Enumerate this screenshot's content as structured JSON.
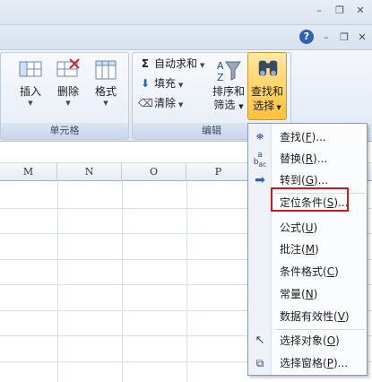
{
  "window_controls": {
    "top": {
      "minimize": "–",
      "restore": "❐",
      "close": "✕"
    },
    "workbook": {
      "help": "?",
      "minimize": "–",
      "restore": "❐",
      "close": "✕"
    }
  },
  "ribbon": {
    "cells_group": {
      "label": "单元格",
      "buttons": [
        {
          "label": "插入",
          "icon": "insert-cells-icon"
        },
        {
          "label": "删除",
          "icon": "delete-cells-icon"
        },
        {
          "label": "格式",
          "icon": "format-cells-icon"
        }
      ]
    },
    "editing_group": {
      "label": "编辑",
      "autosum": "自动求和",
      "fill": "填充",
      "clear": "清除",
      "sort_filter": {
        "line1": "排序和",
        "line2": "筛选"
      },
      "find_select": {
        "line1": "查找和",
        "line2": "选择"
      }
    }
  },
  "sheet": {
    "columns": [
      "M",
      "N",
      "O",
      "P"
    ]
  },
  "menu": {
    "items": [
      {
        "text": "查找(",
        "key": "F",
        "tail": ")...",
        "icon": "binoculars-icon"
      },
      {
        "text": "替换(",
        "key": "R",
        "tail": ")...",
        "icon": "replace-icon"
      },
      {
        "text": "转到(",
        "key": "G",
        "tail": ")...",
        "icon": "goto-arrow-icon"
      },
      {
        "text": "定位条件(",
        "key": "S",
        "tail": ")...",
        "icon": ""
      },
      {
        "text": "公式(",
        "key": "U",
        "tail": ")",
        "icon": ""
      },
      {
        "text": "批注(",
        "key": "M",
        "tail": ")",
        "icon": ""
      },
      {
        "text": "条件格式(",
        "key": "C",
        "tail": ")",
        "icon": ""
      },
      {
        "text": "常量(",
        "key": "N",
        "tail": ")",
        "icon": ""
      },
      {
        "text": "数据有效性(",
        "key": "V",
        "tail": ")",
        "icon": ""
      },
      {
        "text": "选择对象(",
        "key": "O",
        "tail": ")",
        "icon": "select-objects-icon"
      },
      {
        "text": "选择窗格(",
        "key": "P",
        "tail": ")...",
        "icon": "selection-pane-icon"
      }
    ]
  },
  "colors": {
    "highlight_box": "#d11717",
    "find_button_active": "#ffd46a"
  }
}
